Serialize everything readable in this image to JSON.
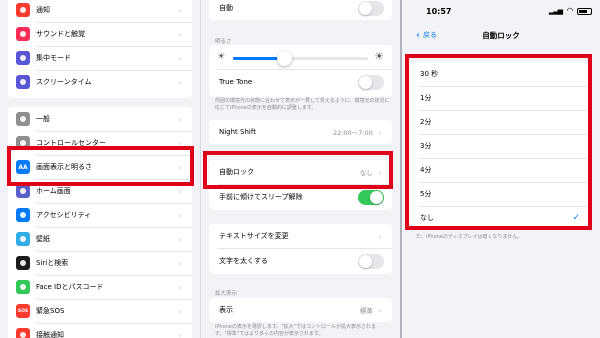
{
  "panel1": {
    "group_a": [
      {
        "label": "通知",
        "icon": "bell-icon",
        "color": "#ff3b30"
      },
      {
        "label": "サウンドと触覚",
        "icon": "speaker-icon",
        "color": "#ff2d55"
      },
      {
        "label": "集中モード",
        "icon": "moon-icon",
        "color": "#5856d6"
      },
      {
        "label": "スクリーンタイム",
        "icon": "hourglass-icon",
        "color": "#5856d6"
      }
    ],
    "group_b": [
      {
        "label": "一般",
        "icon": "gear-icon",
        "color": "#8e8e93"
      },
      {
        "label": "コントロールセンター",
        "icon": "sliders-icon",
        "color": "#8e8e93"
      },
      {
        "label": "画面表示と明るさ",
        "icon": "aa-icon",
        "color": "#007aff",
        "glyph": "AA"
      },
      {
        "label": "ホーム画面",
        "icon": "grid-icon",
        "color": "#5b5fc7"
      },
      {
        "label": "アクセシビリティ",
        "icon": "accessibility-icon",
        "color": "#007aff"
      },
      {
        "label": "壁紙",
        "icon": "flower-icon",
        "color": "#32ade6"
      },
      {
        "label": "Siriと検索",
        "icon": "siri-icon",
        "color": "#1c1c1e"
      },
      {
        "label": "Face IDとパスコード",
        "icon": "face-id-icon",
        "color": "#34c759"
      },
      {
        "label": "緊急SOS",
        "icon": "sos-icon",
        "color": "#ff3b30",
        "glyph": "SOS"
      },
      {
        "label": "接触通知",
        "icon": "contact-icon",
        "color": "#ff3b30"
      }
    ]
  },
  "panel2": {
    "auto_label": "自動",
    "brightness_header": "明るさ",
    "brightness_level": 0.38,
    "true_tone_label": "True Tone",
    "true_tone_note": "周囲の環境光の状態に合わせて表示が一貫して見えるように、環境光の状況に応じてiPhoneの表示を自動的に調整します。",
    "night_shift_label": "Night Shift",
    "night_shift_value": "22:00～7:00",
    "auto_lock_label": "自動ロック",
    "auto_lock_value": "なし",
    "raise_to_wake_label": "手前に傾けてスリープ解除",
    "text_size_label": "テキストサイズを変更",
    "bold_text_label": "文字を太くする",
    "zoom_header": "拡大表示",
    "display_label": "表示",
    "display_value": "標準",
    "display_note": "iPhoneの表示を選択します。\"拡大\"ではコントロールが拡大表示されます。\"標準\"ではより多くの内容が表示されます。"
  },
  "panel3": {
    "time": "10:57",
    "back_label": "戻る",
    "title": "自動ロック",
    "options": [
      "30 秒",
      "1分",
      "2分",
      "3分",
      "4分",
      "5分",
      "なし"
    ],
    "selected_index": 6,
    "footer": "た、iPhoneのディスプレイは暗くなりません。"
  }
}
